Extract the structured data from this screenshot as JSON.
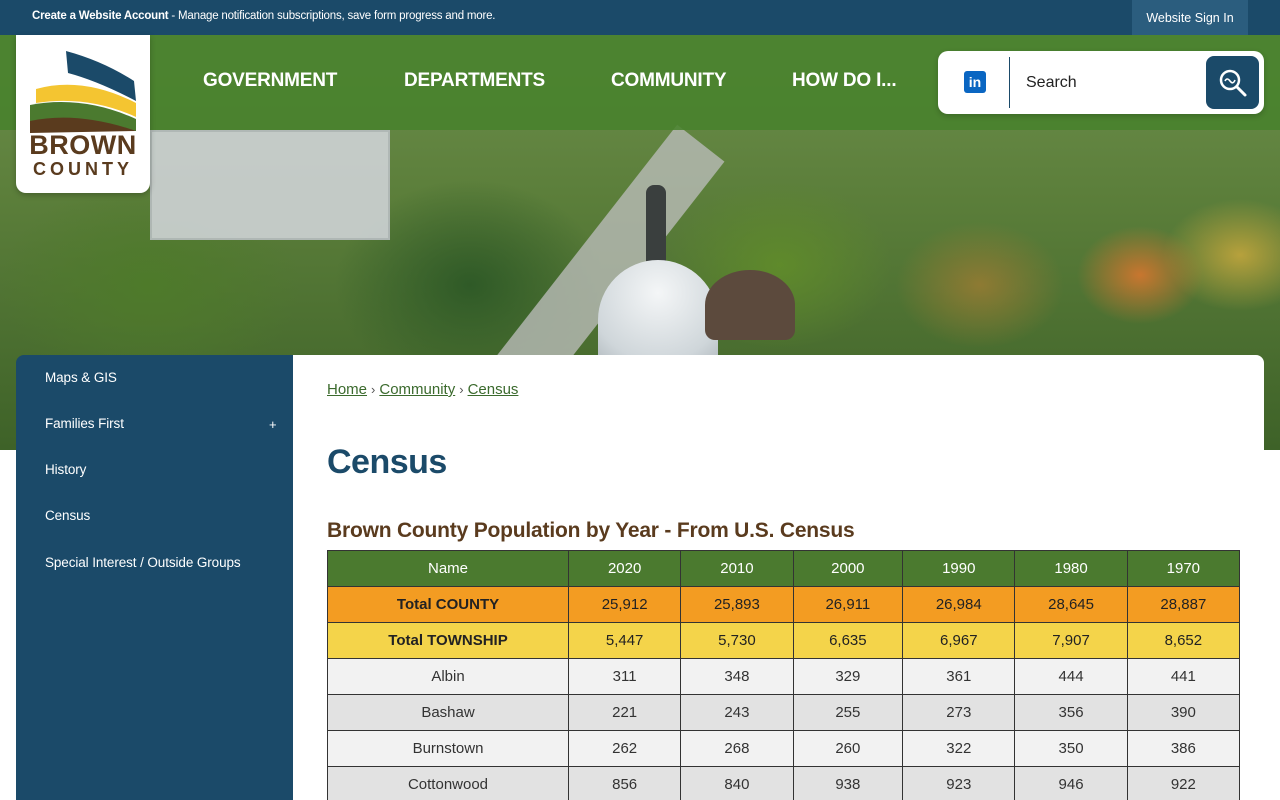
{
  "topbar": {
    "account_link": "Create a Website Account",
    "account_text": " - Manage notification subscriptions, save form progress and more.",
    "signin": "Website Sign In"
  },
  "logo": {
    "line1": "BROWN",
    "line2": "COUNTY"
  },
  "nav": {
    "items": [
      "GOVERNMENT",
      "DEPARTMENTS",
      "COMMUNITY",
      "HOW DO I..."
    ]
  },
  "search": {
    "placeholder": "Search",
    "social": "in"
  },
  "sidebar": {
    "items": [
      "Maps & GIS",
      "Families First",
      "History",
      "Census",
      "Special Interest / Outside Groups"
    ],
    "expand_symbol": "+"
  },
  "breadcrumb": {
    "items": [
      "Home",
      "Community",
      "Census"
    ],
    "separator": "›"
  },
  "page": {
    "title": "Census",
    "subheading": "Brown County Population by Year - From U.S. Census"
  },
  "table": {
    "headers": [
      "Name",
      "2020",
      "2010",
      "2000",
      "1990",
      "1980",
      "1970"
    ],
    "rows": [
      [
        "Total COUNTY",
        "25,912",
        "25,893",
        "26,911",
        "26,984",
        "28,645",
        "28,887"
      ],
      [
        "Total TOWNSHIP",
        "5,447",
        "5,730",
        "6,635",
        "6,967",
        "7,907",
        "8,652"
      ],
      [
        "Albin",
        "311",
        "348",
        "329",
        "361",
        "444",
        "441"
      ],
      [
        "Bashaw",
        "221",
        "243",
        "255",
        "273",
        "356",
        "390"
      ],
      [
        "Burnstown",
        "262",
        "268",
        "260",
        "322",
        "350",
        "386"
      ],
      [
        "Cottonwood",
        "856",
        "840",
        "938",
        "923",
        "946",
        "922"
      ]
    ]
  },
  "colors": {
    "navy": "#1b4a69",
    "green": "#4b7a2f",
    "orange": "#f39c22",
    "yellow": "#f4d44a",
    "brown": "#5a3b1e"
  }
}
